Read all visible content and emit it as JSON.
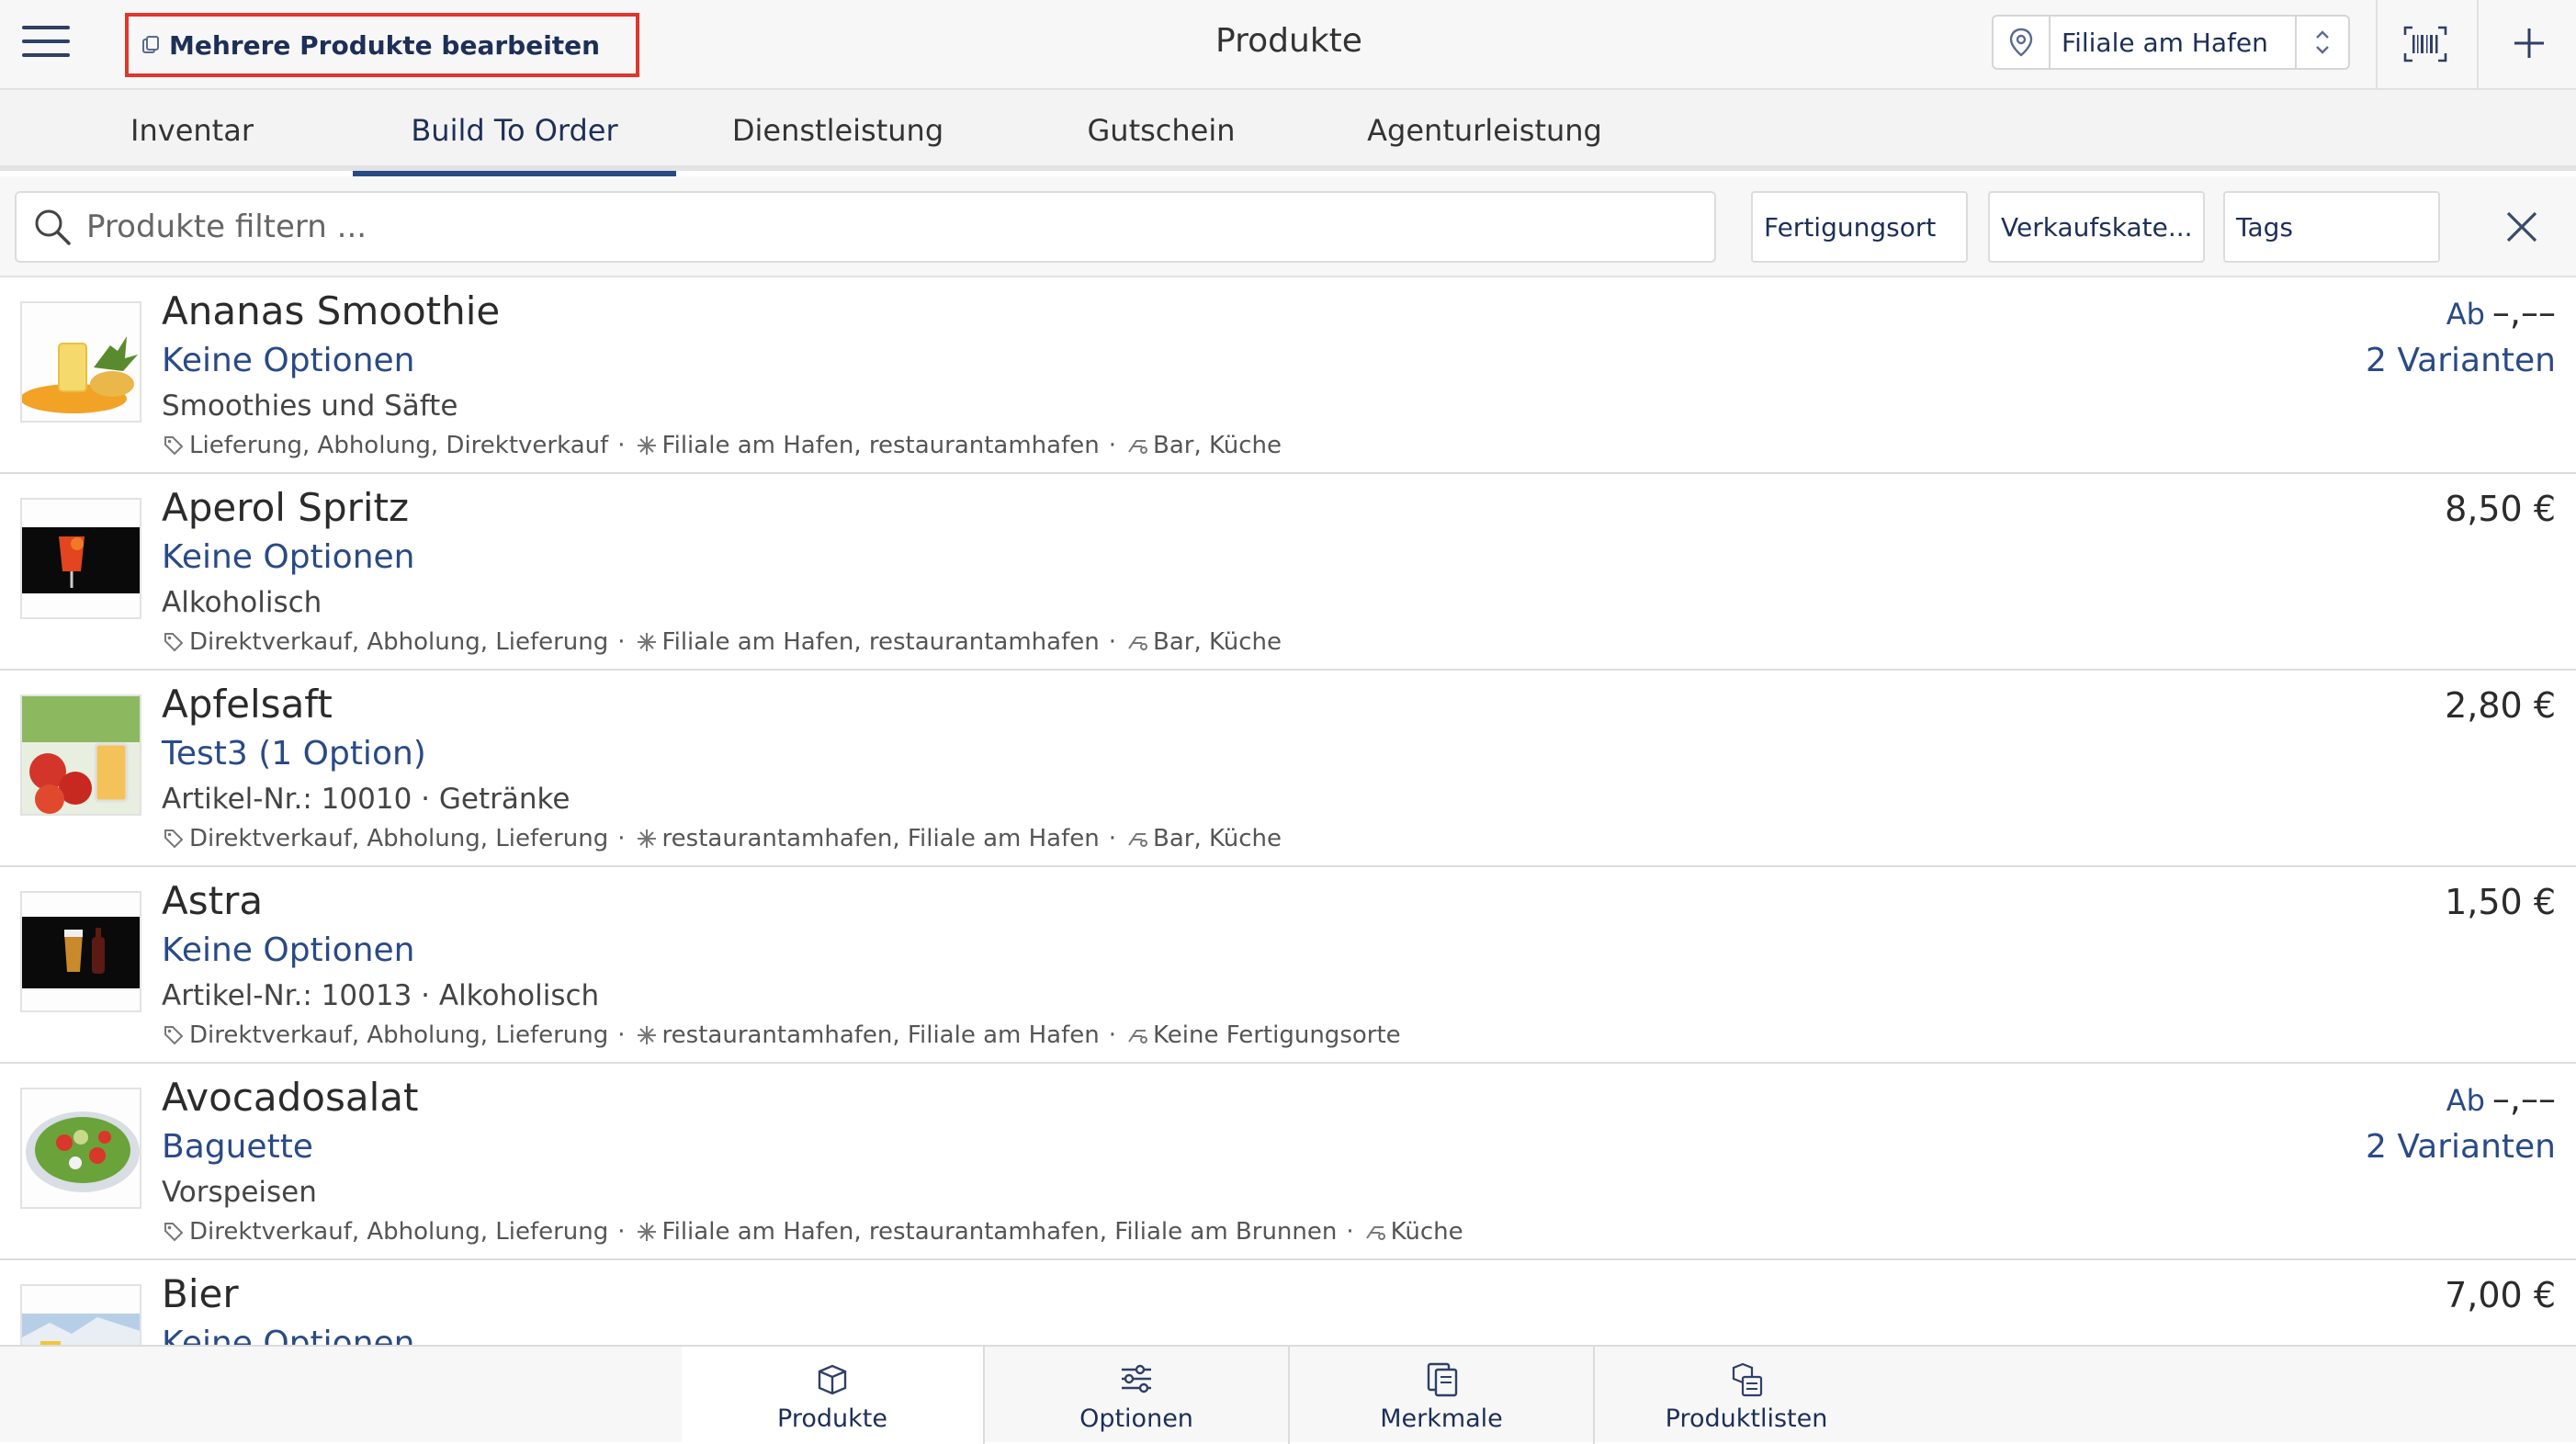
{
  "header": {
    "bulk_edit_label": "Mehrere Produkte bearbeiten",
    "title": "Produkte",
    "branch_value": "Filiale am Hafen"
  },
  "tabs": [
    {
      "label": "Inventar"
    },
    {
      "label": "Build To Order"
    },
    {
      "label": "Dienstleistung"
    },
    {
      "label": "Gutschein"
    },
    {
      "label": "Agenturleistung"
    }
  ],
  "active_tab": "Build To Order",
  "filters": {
    "search_placeholder": "Produkte filtern ...",
    "fertigungsort": "Fertigungsort",
    "verkaufskategorie": "Verkaufskate...",
    "tags": "Tags"
  },
  "products": [
    {
      "name": "Ananas Smoothie",
      "options": "Keine Optionen",
      "category": "Smoothies und Säfte",
      "channels": "Lieferung, Abholung, Direktverkauf",
      "branches": "Filiale am Hafen, restaurantamhafen",
      "stations": "Bar, Küche",
      "price_prefix": "Ab",
      "price": "–,––",
      "variants": "2 Varianten"
    },
    {
      "name": "Aperol Spritz",
      "options": "Keine Optionen",
      "category": "Alkoholisch",
      "channels": "Direktverkauf, Abholung, Lieferung",
      "branches": "Filiale am Hafen, restaurantamhafen",
      "stations": "Bar, Küche",
      "price": "8,50 €"
    },
    {
      "name": "Apfelsaft",
      "options": "Test3 (1 Option)",
      "category": "Artikel-Nr.: 10010 · Getränke",
      "channels": "Direktverkauf, Abholung, Lieferung",
      "branches": "restaurantamhafen, Filiale am Hafen",
      "stations": "Bar, Küche",
      "price": "2,80 €"
    },
    {
      "name": "Astra",
      "options": "Keine Optionen",
      "category": "Artikel-Nr.: 10013 · Alkoholisch",
      "channels": "Direktverkauf, Abholung, Lieferung",
      "branches": "restaurantamhafen, Filiale am Hafen",
      "stations": "Keine Fertigungsorte",
      "price": "1,50 €"
    },
    {
      "name": "Avocadosalat",
      "options": "Baguette",
      "category": "Vorspeisen",
      "channels": "Direktverkauf, Abholung, Lieferung",
      "branches": "Filiale am Hafen, restaurantamhafen, Filiale am Brunnen",
      "stations": "Küche",
      "price_prefix": "Ab",
      "price": "–,––",
      "variants": "2 Varianten"
    },
    {
      "name": "Bier",
      "options": "Keine Optionen",
      "price": "7,00 €"
    }
  ],
  "separator": "·",
  "bottom_nav": [
    {
      "label": "Produkte"
    },
    {
      "label": "Optionen"
    },
    {
      "label": "Merkmale"
    },
    {
      "label": "Produktlisten"
    }
  ],
  "colors": {
    "accent": "#2a4a86",
    "text_dark": "#1e2f57",
    "highlight_border": "#e0362d"
  }
}
